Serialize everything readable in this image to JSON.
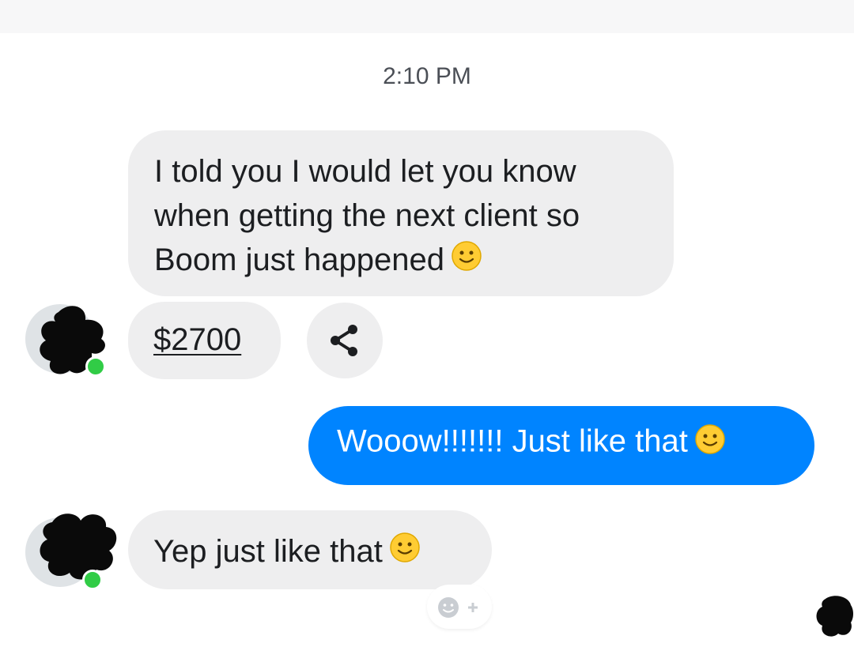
{
  "header": {
    "timestamp": "2:10 PM"
  },
  "messages": [
    {
      "direction": "incoming",
      "text": "I told you I would let you know when getting the next client so Boom just happened",
      "emoji": "slightly-smiling-face"
    },
    {
      "direction": "incoming",
      "link_text": "$2700",
      "action_icon": "share-icon"
    },
    {
      "direction": "outgoing",
      "text": "Wooow!!!!!!! Just like that",
      "emoji": "slightly-smiling-face"
    },
    {
      "direction": "incoming",
      "text": "Yep just like that",
      "emoji": "slightly-smiling-face"
    }
  ],
  "react_button": {
    "icon": "add-reaction-icon"
  },
  "colors": {
    "outgoing_bubble": "#0084ff",
    "incoming_bubble": "#eeeeef",
    "online_indicator": "#31cc46"
  }
}
